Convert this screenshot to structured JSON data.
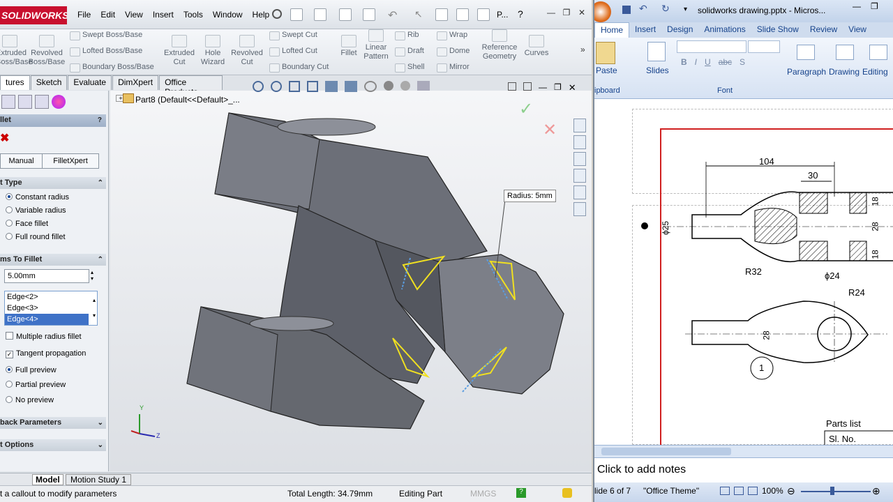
{
  "solidworks": {
    "logo": "SOLIDWORKS",
    "menu": [
      "File",
      "Edit",
      "View",
      "Insert",
      "Tools",
      "Window",
      "Help"
    ],
    "search_label": "P...",
    "ribbon": {
      "extruded_boss": "Extruded Boss/Base",
      "revolved_boss": "Revolved Boss/Base",
      "swept_boss": "Swept Boss/Base",
      "lofted_boss": "Lofted Boss/Base",
      "boundary_boss": "Boundary Boss/Base",
      "extruded_cut": "Extruded Cut",
      "hole_wizard": "Hole Wizard",
      "revolved_cut": "Revolved Cut",
      "swept_cut": "Swept Cut",
      "lofted_cut": "Lofted Cut",
      "boundary_cut": "Boundary Cut",
      "fillet": "Fillet",
      "linear_pattern": "Linear Pattern",
      "rib": "Rib",
      "draft": "Draft",
      "shell": "Shell",
      "wrap": "Wrap",
      "dome": "Dome",
      "mirror": "Mirror",
      "reference_geometry": "Reference Geometry",
      "curves": "Curves"
    },
    "tabs": [
      "tures",
      "Sketch",
      "Evaluate",
      "DimXpert",
      "Office Products"
    ],
    "tree_label": "Part8  (Default<<Default>_...",
    "panel": {
      "title": "llet",
      "mode_manual": "Manual",
      "mode_filletxpert": "FilletXpert",
      "section_type": "t Type",
      "type_options": [
        "Constant radius",
        "Variable radius",
        "Face fillet",
        "Full round fillet"
      ],
      "section_items": "ms To Fillet",
      "radius_value": "5.00mm",
      "edges": [
        "Edge<2>",
        "Edge<3>",
        "Edge<4>"
      ],
      "multiple_radius": "Multiple radius fillet",
      "tangent_propagation": "Tangent propagation",
      "preview_options": [
        "Full preview",
        "Partial preview",
        "No preview"
      ],
      "section_setback": "back Parameters",
      "section_options": "t Options"
    },
    "callout": "Radius:  5mm",
    "bottom_tabs": [
      "Model",
      "Motion Study 1"
    ],
    "status": {
      "hint": "t a callout to modify parameters",
      "total_length": "Total Length: 34.79mm",
      "mode": "Editing Part",
      "units": "MMGS"
    }
  },
  "powerpoint": {
    "title": "solidworks drawing.pptx - Micros...",
    "tabs": [
      "Home",
      "Insert",
      "Design",
      "Animations",
      "Slide Show",
      "Review",
      "View"
    ],
    "groups": {
      "paste": "Paste",
      "clipboard": "ipboard",
      "slides": "Slides",
      "font": "Font",
      "paragraph": "Paragraph",
      "drawing": "Drawing",
      "editing": "Editing"
    },
    "drawing": {
      "dim_104": "104",
      "dim_30": "30",
      "dim_18a": "18",
      "dim_28": "28",
      "dim_18b": "18",
      "dim_phi25": "ϕ25",
      "dim_r32": "R32",
      "dim_phi24": "ϕ24",
      "dim_r24": "R24",
      "dim_28b": "28",
      "balloon": "1",
      "parts_list": "Parts list",
      "sl_no": "Sl. No."
    },
    "notes": "Click to add notes",
    "status": {
      "slide": "lide 6 of 7",
      "theme": "\"Office Theme\"",
      "zoom": "100%"
    }
  }
}
